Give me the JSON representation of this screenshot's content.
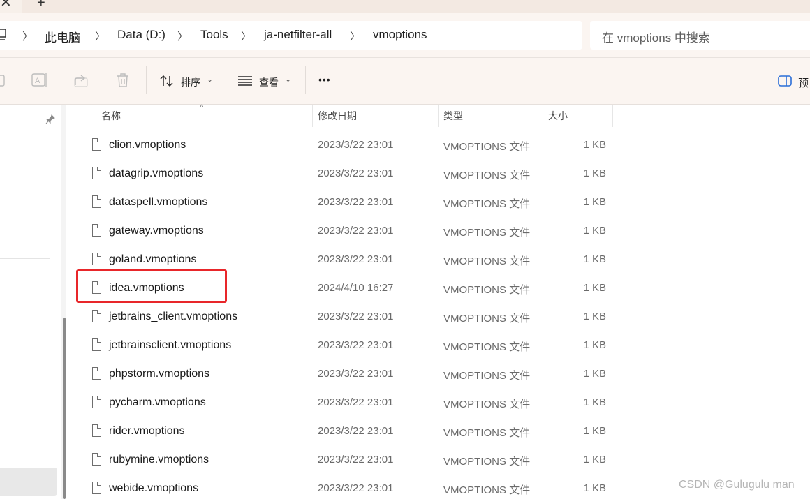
{
  "tabs": {
    "active_icon": "close-icon",
    "new_tab_glyph": "+"
  },
  "breadcrumb": {
    "items": [
      "此电脑",
      "Data (D:)",
      "Tools",
      "ja-netfilter-all",
      "vmoptions"
    ]
  },
  "search": {
    "placeholder": "在 vmoptions 中搜索"
  },
  "toolbar": {
    "sort_label": "排序",
    "view_label": "查看",
    "more_label": "•••",
    "preview_label": "预"
  },
  "columns": {
    "name": "名称",
    "modified": "修改日期",
    "type": "类型",
    "size": "大小"
  },
  "files": [
    {
      "name": "clion.vmoptions",
      "modified": "2023/3/22 23:01",
      "type": "VMOPTIONS 文件",
      "size": "1 KB"
    },
    {
      "name": "datagrip.vmoptions",
      "modified": "2023/3/22 23:01",
      "type": "VMOPTIONS 文件",
      "size": "1 KB"
    },
    {
      "name": "dataspell.vmoptions",
      "modified": "2023/3/22 23:01",
      "type": "VMOPTIONS 文件",
      "size": "1 KB"
    },
    {
      "name": "gateway.vmoptions",
      "modified": "2023/3/22 23:01",
      "type": "VMOPTIONS 文件",
      "size": "1 KB"
    },
    {
      "name": "goland.vmoptions",
      "modified": "2023/3/22 23:01",
      "type": "VMOPTIONS 文件",
      "size": "1 KB"
    },
    {
      "name": "idea.vmoptions",
      "modified": "2024/4/10 16:27",
      "type": "VMOPTIONS 文件",
      "size": "1 KB"
    },
    {
      "name": "jetbrains_client.vmoptions",
      "modified": "2023/3/22 23:01",
      "type": "VMOPTIONS 文件",
      "size": "1 KB"
    },
    {
      "name": "jetbrainsclient.vmoptions",
      "modified": "2023/3/22 23:01",
      "type": "VMOPTIONS 文件",
      "size": "1 KB"
    },
    {
      "name": "phpstorm.vmoptions",
      "modified": "2023/3/22 23:01",
      "type": "VMOPTIONS 文件",
      "size": "1 KB"
    },
    {
      "name": "pycharm.vmoptions",
      "modified": "2023/3/22 23:01",
      "type": "VMOPTIONS 文件",
      "size": "1 KB"
    },
    {
      "name": "rider.vmoptions",
      "modified": "2023/3/22 23:01",
      "type": "VMOPTIONS 文件",
      "size": "1 KB"
    },
    {
      "name": "rubymine.vmoptions",
      "modified": "2023/3/22 23:01",
      "type": "VMOPTIONS 文件",
      "size": "1 KB"
    },
    {
      "name": "webide.vmoptions",
      "modified": "2023/3/22 23:01",
      "type": "VMOPTIONS 文件",
      "size": "1 KB"
    }
  ],
  "highlighted_file": "idea.vmoptions",
  "highlight_color": "#e8262a",
  "watermark": "CSDN @Gulugulu man"
}
